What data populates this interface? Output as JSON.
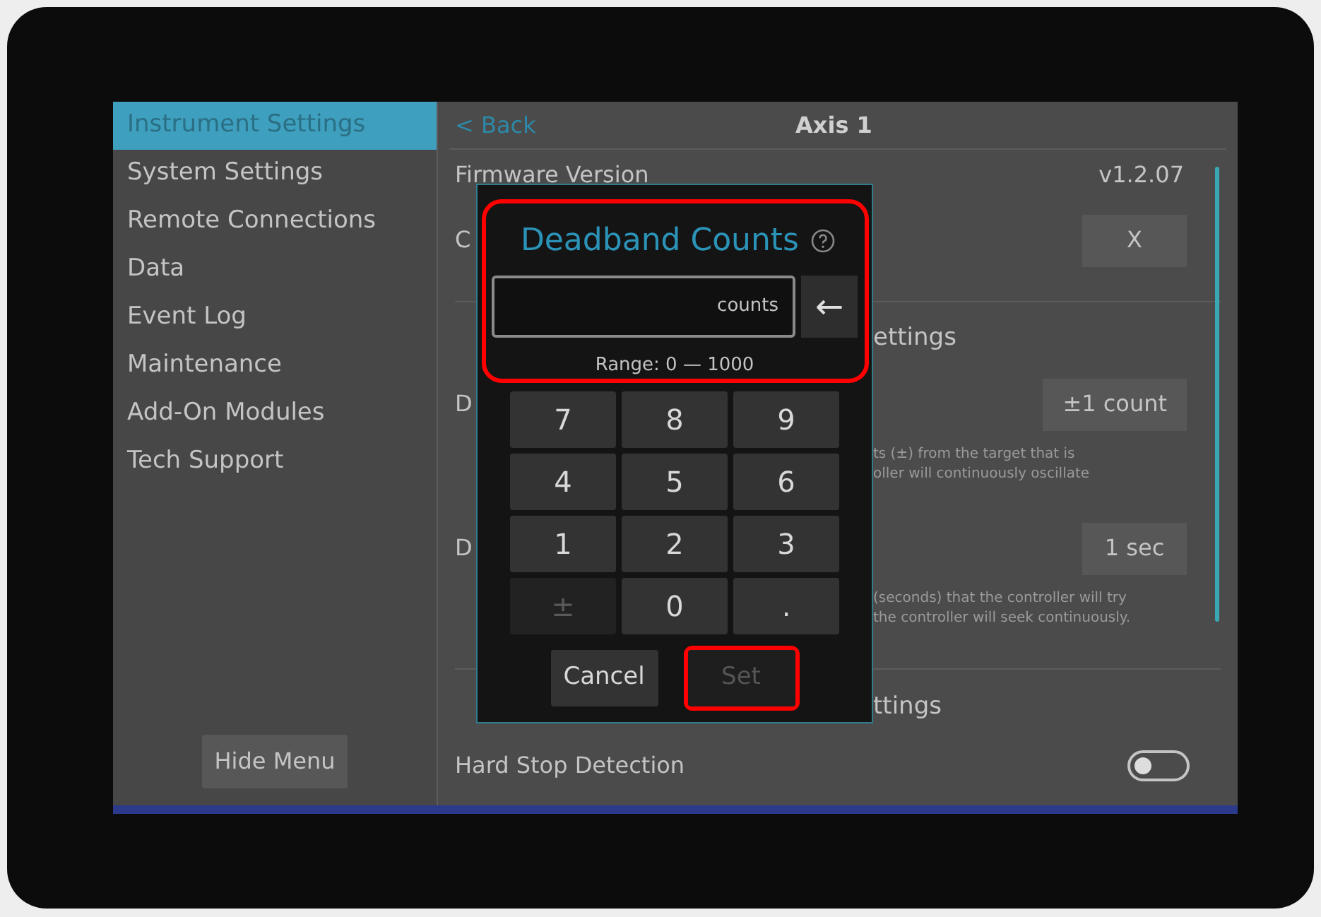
{
  "sidebar": {
    "items": [
      {
        "label": "Instrument Settings",
        "selected": true
      },
      {
        "label": "System Settings",
        "selected": false
      },
      {
        "label": "Remote Connections",
        "selected": false
      },
      {
        "label": "Data",
        "selected": false
      },
      {
        "label": "Event Log",
        "selected": false
      },
      {
        "label": "Maintenance",
        "selected": false
      },
      {
        "label": "Add-On Modules",
        "selected": false
      },
      {
        "label": "Tech Support",
        "selected": false
      }
    ],
    "hide_button": "Hide Menu"
  },
  "header": {
    "back": "< Back",
    "title": "Axis 1"
  },
  "rows": [
    {
      "kind": "value",
      "label": "Firmware Version",
      "value": "v1.2.07"
    },
    {
      "kind": "button",
      "label": "C",
      "button": "X"
    },
    {
      "kind": "heading",
      "label": "ettings"
    },
    {
      "kind": "button",
      "label": "D",
      "button": "±1 count",
      "description": [
        "ts (±) from the target that is",
        "oller will continuously oscillate"
      ]
    },
    {
      "kind": "button",
      "label": "D",
      "button": "1 sec",
      "description": [
        "(seconds) that the controller will try",
        "the controller will seek continuously."
      ]
    },
    {
      "kind": "heading",
      "label": "ttings"
    },
    {
      "kind": "toggle",
      "label": "Hard Stop Detection",
      "on": false
    }
  ],
  "dialog": {
    "title": "Deadband Counts",
    "unit": "counts",
    "backspace": "←",
    "range": "Range: 0 — 1000",
    "header_highlighted": true,
    "keys": [
      {
        "label": "7",
        "disabled": false
      },
      {
        "label": "8",
        "disabled": false
      },
      {
        "label": "9",
        "disabled": false
      },
      {
        "label": "4",
        "disabled": false
      },
      {
        "label": "5",
        "disabled": false
      },
      {
        "label": "6",
        "disabled": false
      },
      {
        "label": "1",
        "disabled": false
      },
      {
        "label": "2",
        "disabled": false
      },
      {
        "label": "3",
        "disabled": false
      },
      {
        "label": "±",
        "disabled": true
      },
      {
        "label": "0",
        "disabled": false
      },
      {
        "label": ".",
        "disabled": false
      }
    ],
    "buttons": [
      {
        "label": "Cancel",
        "disabled": false,
        "highlighted": false
      },
      {
        "label": "Set",
        "disabled": true,
        "highlighted": true
      }
    ]
  }
}
